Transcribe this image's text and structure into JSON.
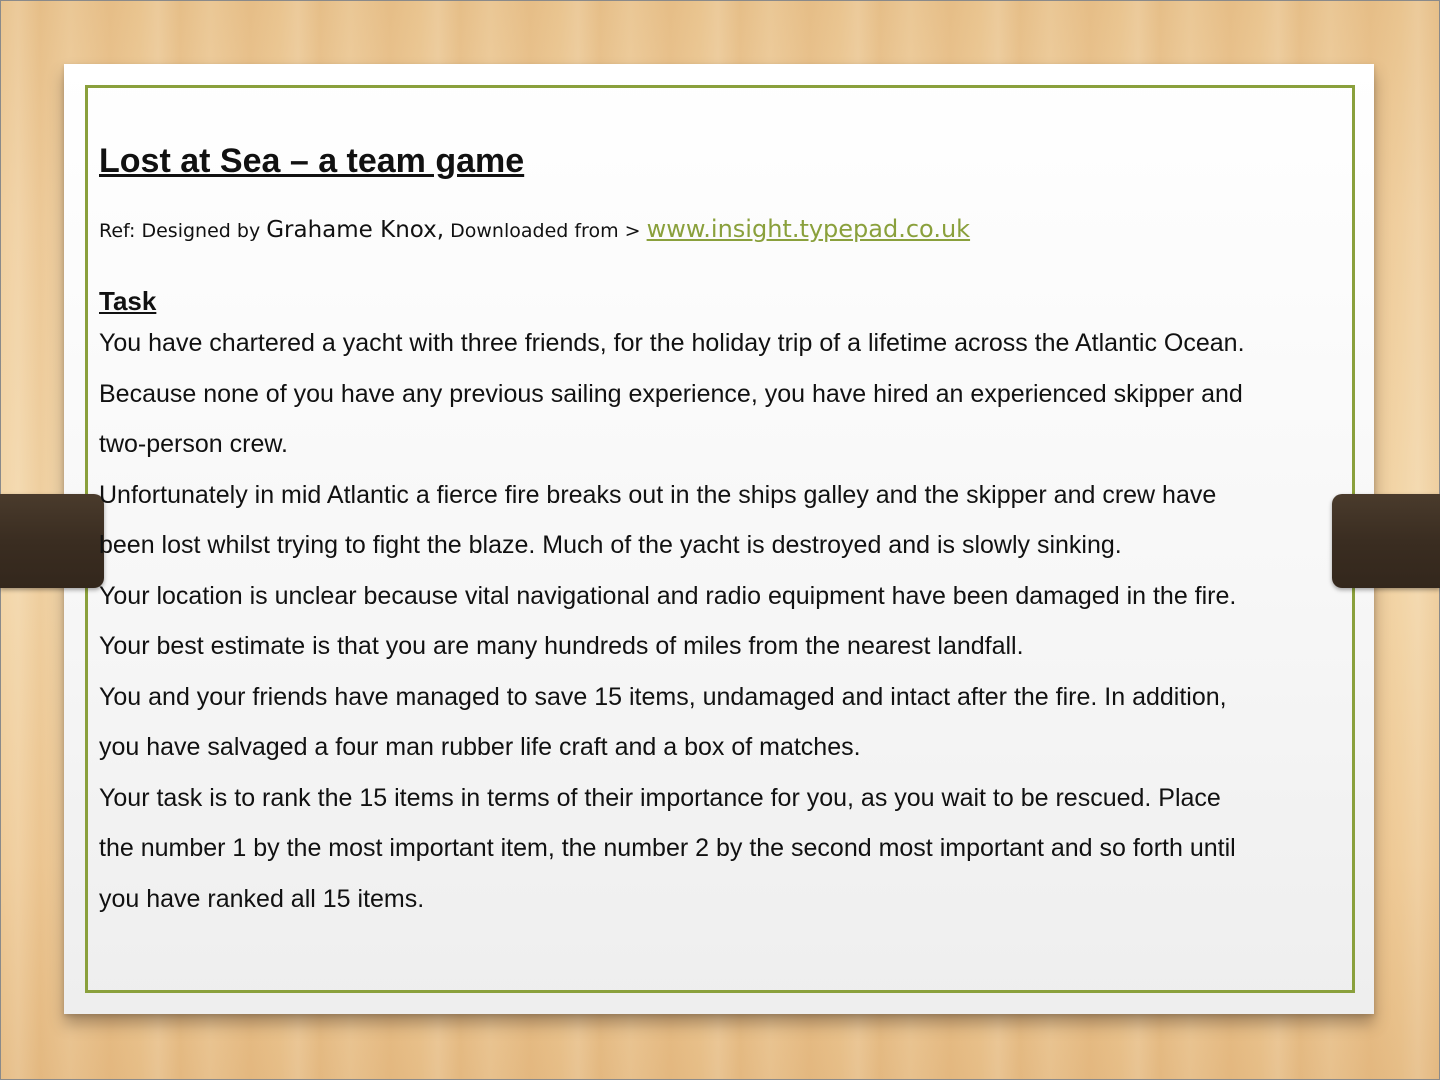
{
  "slide": {
    "title": "Lost at Sea – a team game",
    "reference": {
      "prefix": "Ref: Designed by ",
      "author": "Grahame Knox,",
      "middle": " Downloaded from > ",
      "link_text": "www.insight.typepad.co.uk"
    },
    "task_heading": "Task",
    "lines": [
      "You have chartered a yacht with three friends, for the holiday trip of a lifetime across the Atlantic Ocean.",
      "Because none of you have any previous sailing experience, you have hired an experienced skipper and",
      "two-person crew.",
      " Unfortunately in mid Atlantic a fierce fire breaks out in the ships galley and the skipper and crew have",
      "been lost whilst trying to fight the blaze. Much of the yacht is destroyed and is slowly sinking.",
      " Your location is unclear because vital navigational and radio equipment have been damaged in the fire.",
      "Your best estimate is that you are many hundreds of miles from the nearest landfall.",
      " You and your friends have managed to save 15 items, undamaged and intact after the fire. In addition,",
      "you have salvaged a four man rubber life craft and a box of matches.",
      " Your task is to rank the 15 items in terms of their importance for you, as you wait to be rescued. Place",
      "the number 1 by the most important item, the number 2 by the second most important and so forth until",
      "you have ranked all 15 items."
    ]
  },
  "colors": {
    "accent_border": "#8aa03c",
    "link": "#8aa03c",
    "strap": "#3a2d21"
  }
}
